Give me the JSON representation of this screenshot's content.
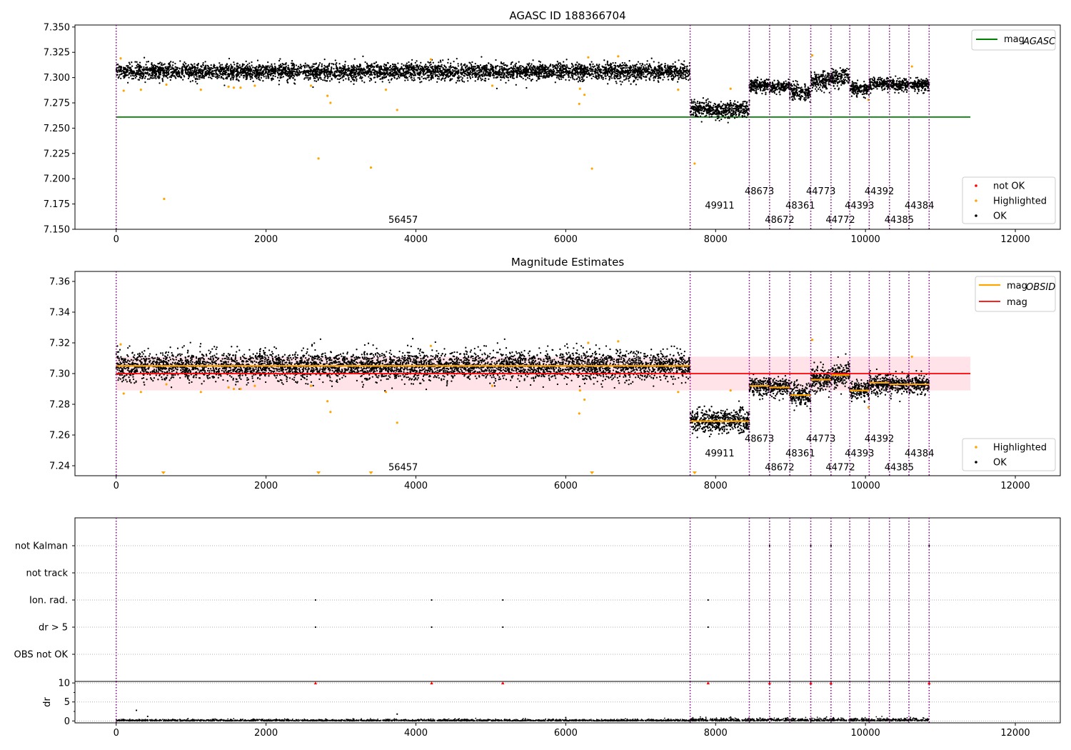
{
  "chart_data": [
    {
      "type": "scatter",
      "title": "AGASC ID 188366704",
      "xlim": [
        -550,
        12600
      ],
      "ylim": [
        7.15,
        7.352
      ],
      "xticks": [
        0,
        2000,
        4000,
        6000,
        8000,
        10000,
        12000
      ],
      "xtick_labels": [
        "0",
        "2000",
        "4000",
        "6000",
        "8000",
        "10000",
        "12000"
      ],
      "yticks": [
        7.15,
        7.175,
        7.2,
        7.225,
        7.25,
        7.275,
        7.3,
        7.325,
        7.35
      ],
      "ytick_labels": [
        "7.150",
        "7.175",
        "7.200",
        "7.225",
        "7.250",
        "7.275",
        "7.300",
        "7.325",
        "7.350"
      ],
      "reference_lines": [
        {
          "name": "mag",
          "subscript": "AGASC",
          "y": 7.261,
          "x_range": [
            0,
            11400
          ],
          "color": "#008000"
        }
      ],
      "legend_line": {
        "label": "mag",
        "subscript": "AGASC",
        "position": "top-right"
      },
      "legend_points": {
        "position": "lower-right",
        "entries": [
          {
            "label": "not OK",
            "color": "#ff0000"
          },
          {
            "label": "Highlighted",
            "color": "#ffa500"
          },
          {
            "label": "OK",
            "color": "#000000"
          }
        ]
      },
      "highlighted_points": [
        {
          "x": 60,
          "y": 7.319
        },
        {
          "x": 100,
          "y": 7.287
        },
        {
          "x": 330,
          "y": 7.288
        },
        {
          "x": 640,
          "y": 7.18
        },
        {
          "x": 670,
          "y": 7.293
        },
        {
          "x": 1130,
          "y": 7.288
        },
        {
          "x": 1500,
          "y": 7.291
        },
        {
          "x": 1570,
          "y": 7.29
        },
        {
          "x": 1660,
          "y": 7.29
        },
        {
          "x": 1850,
          "y": 7.292
        },
        {
          "x": 2600,
          "y": 7.292
        },
        {
          "x": 2700,
          "y": 7.22
        },
        {
          "x": 2820,
          "y": 7.282
        },
        {
          "x": 2860,
          "y": 7.275
        },
        {
          "x": 3400,
          "y": 7.211
        },
        {
          "x": 3600,
          "y": 7.288
        },
        {
          "x": 3750,
          "y": 7.268
        },
        {
          "x": 4200,
          "y": 7.318
        },
        {
          "x": 5020,
          "y": 7.292
        },
        {
          "x": 6180,
          "y": 7.274
        },
        {
          "x": 6190,
          "y": 7.289
        },
        {
          "x": 6250,
          "y": 7.283
        },
        {
          "x": 6300,
          "y": 7.32
        },
        {
          "x": 6350,
          "y": 7.21
        },
        {
          "x": 6700,
          "y": 7.321
        },
        {
          "x": 7500,
          "y": 7.288
        },
        {
          "x": 7720,
          "y": 7.215
        },
        {
          "x": 8200,
          "y": 7.289
        },
        {
          "x": 9290,
          "y": 7.322
        },
        {
          "x": 10040,
          "y": 7.278
        },
        {
          "x": 10620,
          "y": 7.311
        }
      ],
      "vlines_x": [
        0,
        7660,
        8450,
        8720,
        8990,
        9270,
        9540,
        9790,
        10050,
        10320,
        10580,
        10850
      ],
      "segments": [
        {
          "obsid": "56457",
          "x0": 0,
          "x1": 7660,
          "mean": 7.306,
          "sd": 0.004
        },
        {
          "obsid": "49911",
          "x0": 7660,
          "x1": 8450,
          "mean": 7.268,
          "sd": 0.004
        },
        {
          "obsid": "48673",
          "x0": 8450,
          "x1": 8720,
          "mean": 7.292,
          "sd": 0.003
        },
        {
          "obsid": "48672",
          "x0": 8720,
          "x1": 8990,
          "mean": 7.291,
          "sd": 0.003
        },
        {
          "obsid": "48361",
          "x0": 8990,
          "x1": 9270,
          "mean": 7.286,
          "sd": 0.004
        },
        {
          "obsid": "44773",
          "x0": 9270,
          "x1": 9540,
          "mean": 7.297,
          "sd": 0.004
        },
        {
          "obsid": "44772",
          "x0": 9540,
          "x1": 9790,
          "mean": 7.3,
          "sd": 0.004
        },
        {
          "obsid": "44393",
          "x0": 9790,
          "x1": 10050,
          "mean": 7.289,
          "sd": 0.003
        },
        {
          "obsid": "44392",
          "x0": 10050,
          "x1": 10320,
          "mean": 7.294,
          "sd": 0.003
        },
        {
          "obsid": "44385",
          "x0": 10320,
          "x1": 10580,
          "mean": 7.293,
          "sd": 0.003
        },
        {
          "obsid": "44384",
          "x0": 10580,
          "x1": 10850,
          "mean": 7.293,
          "sd": 0.003
        }
      ],
      "obsid_labels": [
        {
          "text": "56457",
          "x": 3830,
          "y": 7.1565
        },
        {
          "text": "49911",
          "x": 8055,
          "y": 7.1705
        },
        {
          "text": "48673",
          "x": 8585,
          "y": 7.1845
        },
        {
          "text": "48672",
          "x": 8855,
          "y": 7.1565
        },
        {
          "text": "48361",
          "x": 9130,
          "y": 7.1705
        },
        {
          "text": "44773",
          "x": 9405,
          "y": 7.1845
        },
        {
          "text": "44772",
          "x": 9665,
          "y": 7.1565
        },
        {
          "text": "44393",
          "x": 9920,
          "y": 7.1705
        },
        {
          "text": "44392",
          "x": 10185,
          "y": 7.1845
        },
        {
          "text": "44385",
          "x": 10450,
          "y": 7.1565
        },
        {
          "text": "44384",
          "x": 10720,
          "y": 7.1705
        }
      ]
    },
    {
      "type": "scatter",
      "title": "Magnitude Estimates",
      "xlim": [
        -550,
        12600
      ],
      "ylim": [
        7.2335,
        7.3665
      ],
      "xticks": [
        0,
        2000,
        4000,
        6000,
        8000,
        10000,
        12000
      ],
      "xtick_labels": [
        "0",
        "2000",
        "4000",
        "6000",
        "8000",
        "10000",
        "12000"
      ],
      "yticks": [
        7.24,
        7.26,
        7.28,
        7.3,
        7.32,
        7.34,
        7.36
      ],
      "ytick_labels": [
        "7.24",
        "7.26",
        "7.28",
        "7.30",
        "7.32",
        "7.34",
        "7.36"
      ],
      "mag_line": {
        "y": 7.3,
        "x_range": [
          0,
          11400
        ],
        "color": "#ff0000",
        "band": [
          7.289,
          7.311
        ],
        "band_color": "#ffc0cb"
      },
      "legend_lines": {
        "position": "top-right",
        "entries": [
          {
            "label": "mag",
            "subscript": "OBSID",
            "color": "#ffa500"
          },
          {
            "label": "mag",
            "subscript": "",
            "color": "#ff0000"
          }
        ]
      },
      "legend_points": {
        "position": "lower-right",
        "entries": [
          {
            "label": "Highlighted",
            "color": "#ffa500"
          },
          {
            "label": "OK",
            "color": "#000000"
          }
        ]
      },
      "obsid_mags": [
        7.305,
        7.269,
        7.292,
        7.291,
        7.286,
        7.296,
        7.299,
        7.289,
        7.294,
        7.293,
        7.293
      ],
      "offscale_markers_x": [
        630,
        2700,
        3400,
        6350,
        7720
      ],
      "obsid_labels": [
        {
          "text": "56457",
          "x": 3830,
          "y": 7.237
        },
        {
          "text": "49911",
          "x": 8055,
          "y": 7.246
        },
        {
          "text": "48673",
          "x": 8585,
          "y": 7.2555
        },
        {
          "text": "48672",
          "x": 8855,
          "y": 7.237
        },
        {
          "text": "48361",
          "x": 9130,
          "y": 7.246
        },
        {
          "text": "44773",
          "x": 9405,
          "y": 7.2555
        },
        {
          "text": "44772",
          "x": 9665,
          "y": 7.237
        },
        {
          "text": "44393",
          "x": 9920,
          "y": 7.246
        },
        {
          "text": "44392",
          "x": 10185,
          "y": 7.2555
        },
        {
          "text": "44385",
          "x": 10450,
          "y": 7.237
        },
        {
          "text": "44384",
          "x": 10720,
          "y": 7.246
        }
      ]
    },
    {
      "type": "scatter",
      "title": "",
      "xlim": [
        -550,
        12600
      ],
      "categories": [
        "OBS not OK",
        "dr > 5",
        "Ion. rad.",
        "not track",
        "not Kalman"
      ],
      "flag_points": [
        {
          "flag": "Ion. rad.",
          "x": [
            2660,
            4210,
            5160,
            7900
          ]
        },
        {
          "flag": "dr > 5",
          "x": [
            2660,
            4210,
            5160,
            7900
          ]
        },
        {
          "flag": "not Kalman",
          "x": [
            8720,
            9270,
            9540,
            10850
          ]
        }
      ]
    },
    {
      "type": "scatter",
      "title": "",
      "ylabel": "dr",
      "xlim": [
        -550,
        12600
      ],
      "ylim": [
        -0.5,
        10.4
      ],
      "xticks": [
        0,
        2000,
        4000,
        6000,
        8000,
        10000,
        12000
      ],
      "xtick_labels": [
        "0",
        "2000",
        "4000",
        "6000",
        "8000",
        "10000",
        "12000"
      ],
      "yticks": [
        0,
        5,
        10
      ],
      "ytick_labels": [
        "0",
        "5",
        "10"
      ],
      "clipped_markers": [
        {
          "x": 2660,
          "y": 10
        },
        {
          "x": 4210,
          "y": 10
        },
        {
          "x": 5160,
          "y": 10
        },
        {
          "x": 7900,
          "y": 10
        },
        {
          "x": 8720,
          "y": 10
        },
        {
          "x": 9270,
          "y": 10
        },
        {
          "x": 9540,
          "y": 10
        },
        {
          "x": 10850,
          "y": 10
        }
      ],
      "sparse_points": [
        {
          "x": 270,
          "y": 2.8
        },
        {
          "x": 420,
          "y": 1.2
        },
        {
          "x": 3750,
          "y": 1.8
        },
        {
          "x": 6000,
          "y": 0.9
        },
        {
          "x": 8200,
          "y": 1.0
        }
      ]
    }
  ]
}
